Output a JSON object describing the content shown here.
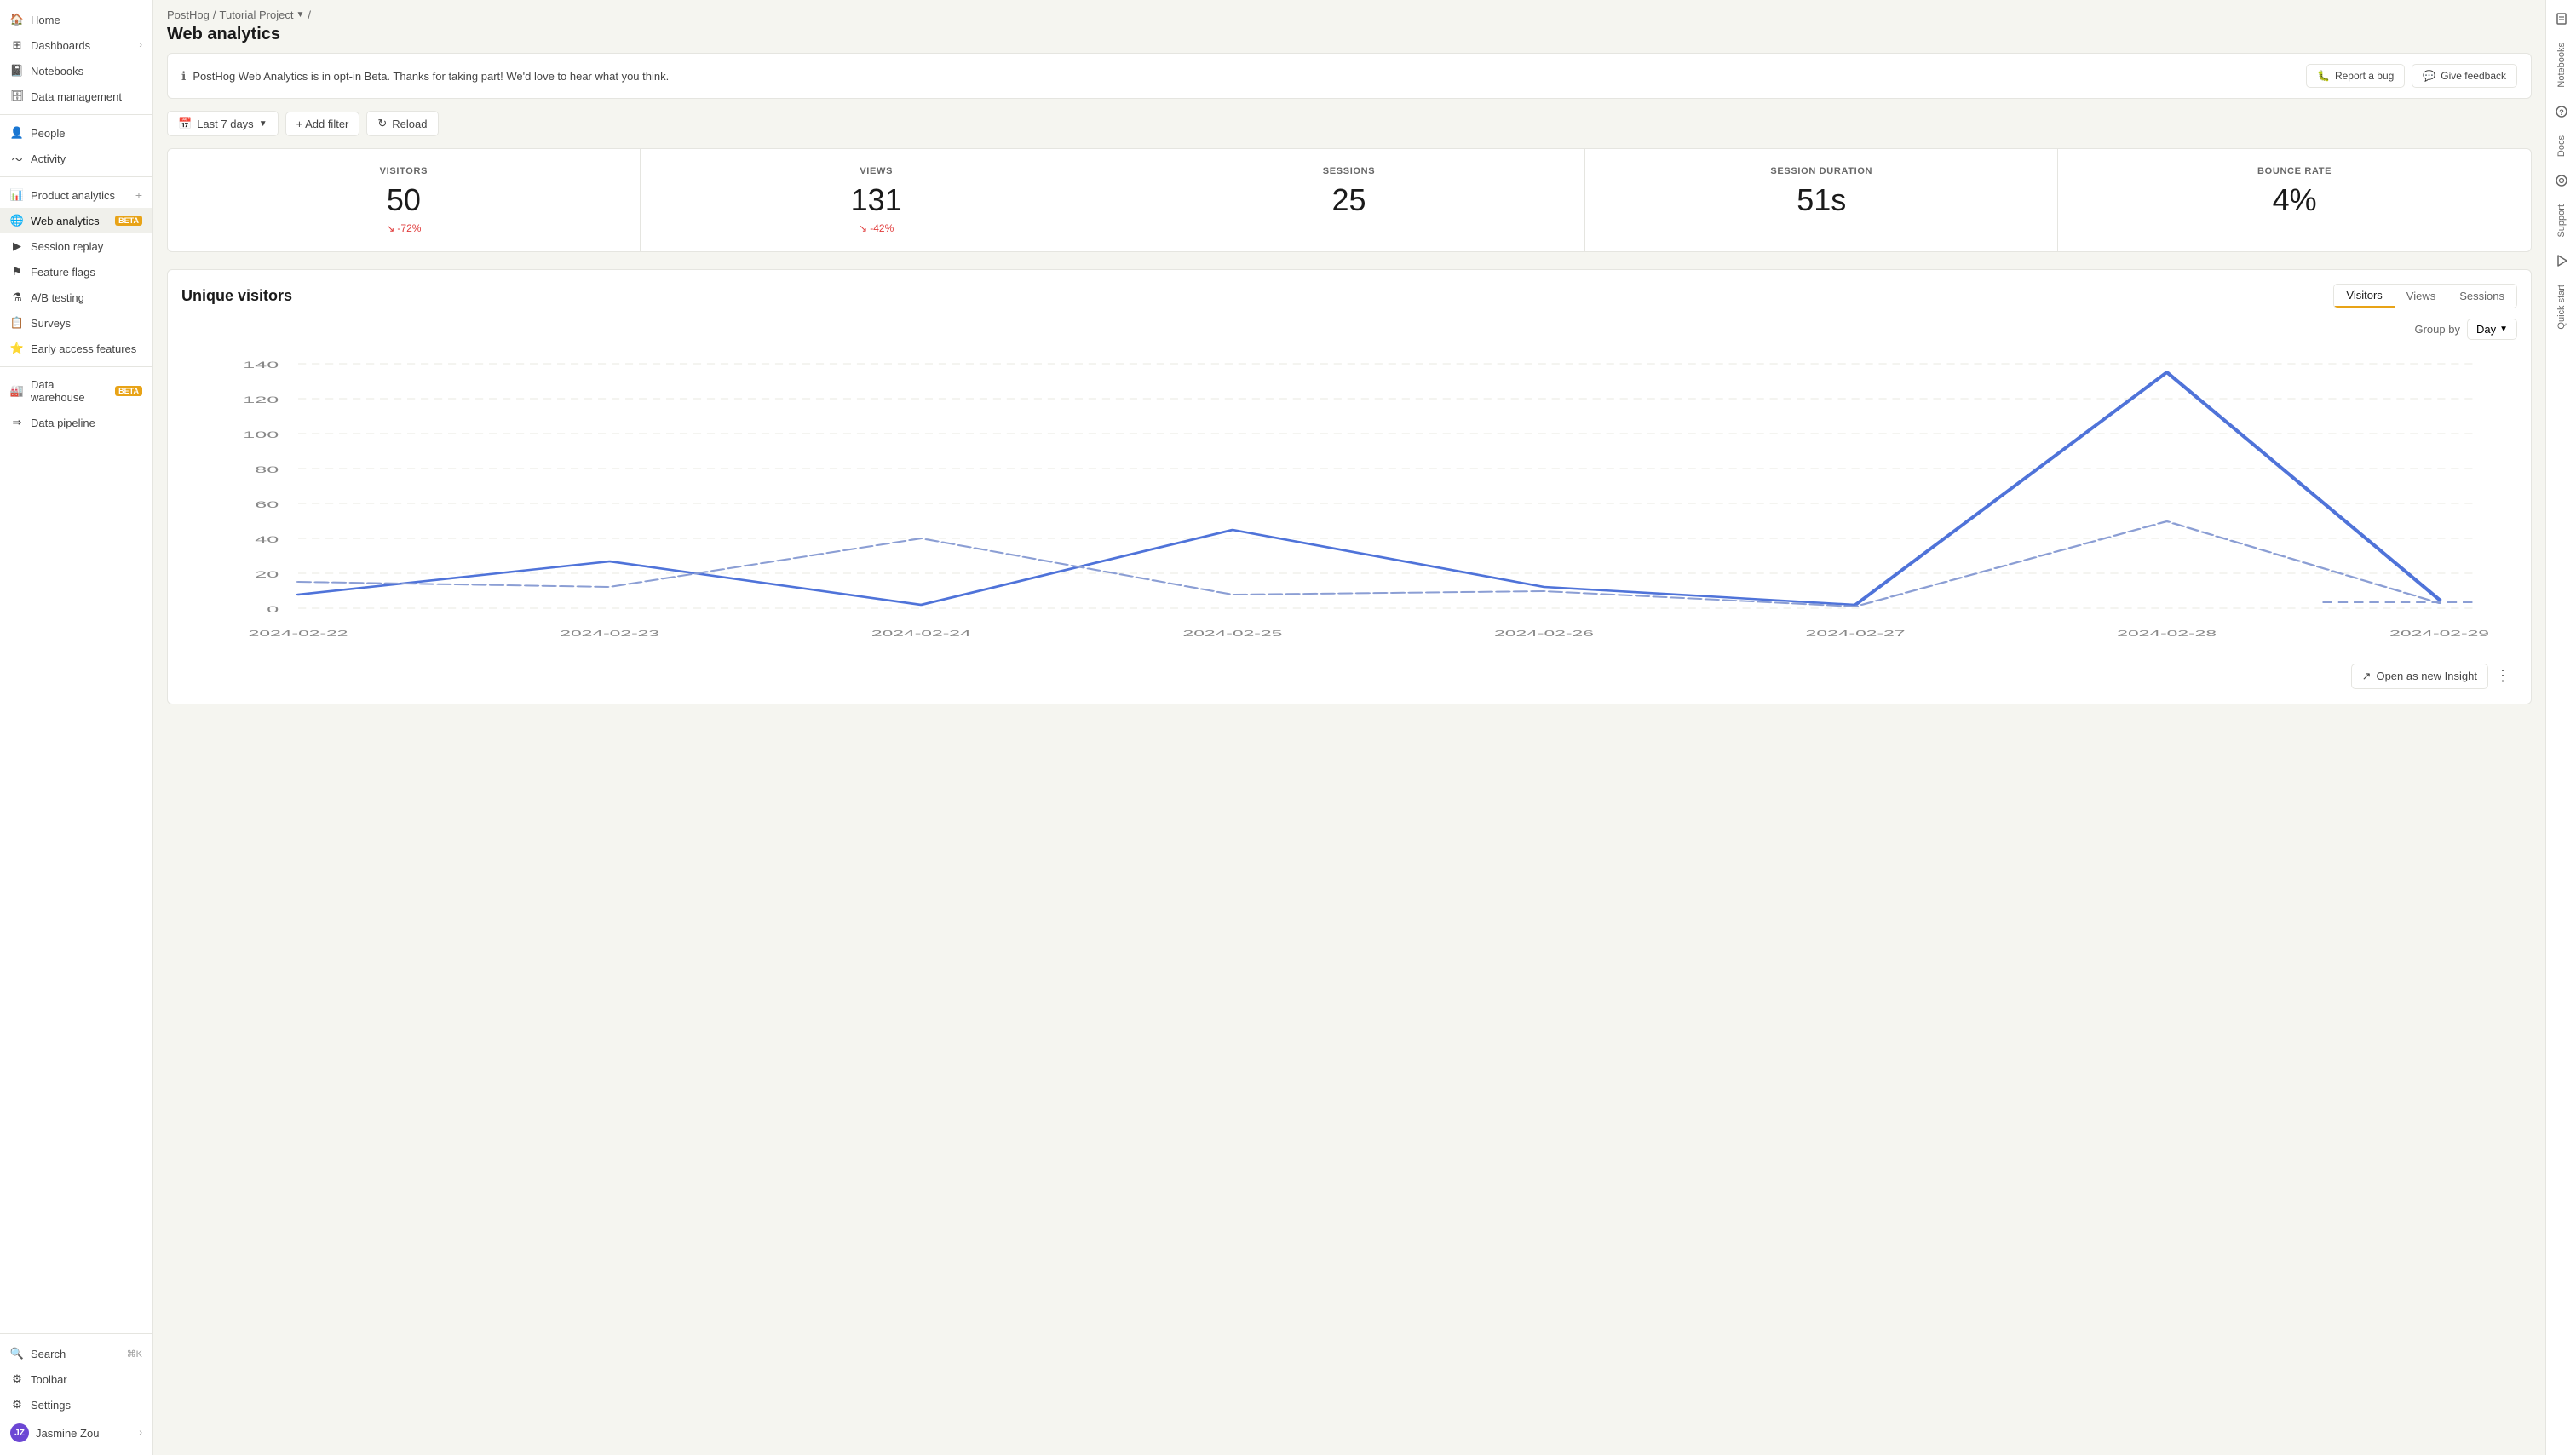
{
  "app": {
    "name": "PostHog",
    "project": "Tutorial Project"
  },
  "breadcrumb": {
    "app": "PostHog",
    "separator1": "/",
    "project": "Tutorial Project",
    "separator2": "/"
  },
  "page": {
    "title": "Web analytics"
  },
  "sidebar": {
    "items": [
      {
        "id": "home",
        "label": "Home",
        "icon": "home-icon"
      },
      {
        "id": "dashboards",
        "label": "Dashboards",
        "icon": "dashboards-icon",
        "hasChevron": true
      },
      {
        "id": "notebooks",
        "label": "Notebooks",
        "icon": "notebooks-icon"
      },
      {
        "id": "data-management",
        "label": "Data management",
        "icon": "data-management-icon"
      },
      {
        "id": "people",
        "label": "People",
        "icon": "people-icon"
      },
      {
        "id": "activity",
        "label": "Activity",
        "icon": "activity-icon"
      },
      {
        "id": "product-analytics",
        "label": "Product analytics",
        "icon": "product-analytics-icon",
        "hasPlus": true
      },
      {
        "id": "web-analytics",
        "label": "Web analytics",
        "icon": "web-analytics-icon",
        "badge": "BETA",
        "active": true
      },
      {
        "id": "session-replay",
        "label": "Session replay",
        "icon": "session-replay-icon"
      },
      {
        "id": "feature-flags",
        "label": "Feature flags",
        "icon": "feature-flags-icon"
      },
      {
        "id": "ab-testing",
        "label": "A/B testing",
        "icon": "ab-testing-icon"
      },
      {
        "id": "surveys",
        "label": "Surveys",
        "icon": "surveys-icon"
      },
      {
        "id": "early-access",
        "label": "Early access features",
        "icon": "early-access-icon"
      },
      {
        "id": "data-warehouse",
        "label": "Data warehouse",
        "icon": "data-warehouse-icon",
        "badge": "BETA"
      },
      {
        "id": "data-pipeline",
        "label": "Data pipeline",
        "icon": "data-pipeline-icon"
      }
    ],
    "bottom": [
      {
        "id": "search",
        "label": "Search",
        "icon": "search-icon",
        "shortcut": "⌘K"
      },
      {
        "id": "toolbar",
        "label": "Toolbar",
        "icon": "toolbar-icon"
      },
      {
        "id": "settings",
        "label": "Settings",
        "icon": "settings-icon"
      }
    ],
    "user": {
      "name": "Jasmine Zou",
      "avatar_initials": "JZ"
    }
  },
  "banner": {
    "text": "PostHog Web Analytics is in opt-in Beta. Thanks for taking part! We'd love to hear what you think.",
    "report_bug_label": "Report a bug",
    "give_feedback_label": "Give feedback"
  },
  "toolbar": {
    "date_range_label": "Last 7 days",
    "add_filter_label": "+ Add filter",
    "reload_label": "Reload"
  },
  "stats": [
    {
      "label": "VISITORS",
      "value": "50",
      "change": "-72%",
      "has_change": true
    },
    {
      "label": "VIEWS",
      "value": "131",
      "change": "-42%",
      "has_change": true
    },
    {
      "label": "SESSIONS",
      "value": "25",
      "change": "",
      "has_change": false
    },
    {
      "label": "SESSION DURATION",
      "value": "51s",
      "change": "",
      "has_change": false
    },
    {
      "label": "BOUNCE RATE",
      "value": "4%",
      "change": "",
      "has_change": false
    }
  ],
  "chart": {
    "title": "Unique visitors",
    "tabs": [
      "Visitors",
      "Views",
      "Sessions"
    ],
    "active_tab": "Visitors",
    "group_by_label": "Group by",
    "group_by_value": "Day",
    "y_axis": [
      0,
      20,
      40,
      60,
      80,
      100,
      120,
      140
    ],
    "x_labels": [
      "2024-02-22",
      "2024-02-23",
      "2024-02-24",
      "2024-02-25",
      "2024-02-26",
      "2024-02-27",
      "2024-02-28",
      "2024-02-29"
    ],
    "visitors_data": [
      8,
      27,
      2,
      45,
      12,
      2,
      135,
      5
    ],
    "views_data": [
      15,
      12,
      40,
      8,
      10,
      1,
      50,
      3
    ],
    "open_insight_label": "Open as new Insight"
  },
  "right_sidebar": {
    "tabs": [
      "Notebooks",
      "Docs",
      "Support",
      "Quick start"
    ]
  }
}
